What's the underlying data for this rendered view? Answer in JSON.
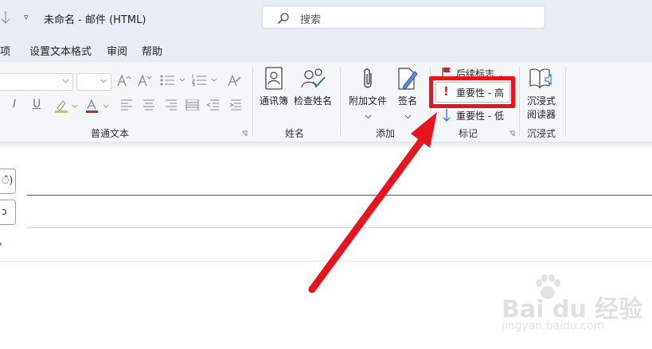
{
  "titlebar": {
    "dropdown_glyph": "▿",
    "title": "未命名  -  邮件 (HTML)"
  },
  "search": {
    "placeholder": "搜索"
  },
  "menubar": {
    "items": [
      "选项",
      "设置文本格式",
      "审阅",
      "帮助"
    ]
  },
  "ribbon": {
    "font_group": {
      "label": "普通文本"
    },
    "names_group": {
      "label": "姓名",
      "address_book": "通讯簿",
      "check_names": "检查姓名"
    },
    "add_group": {
      "label": "添加",
      "attach_file": "附加文件",
      "signature": "签名"
    },
    "tags_group": {
      "label": "标记",
      "follow_up": "后续标志",
      "high_importance": "重要性 - 高",
      "low_importance": "重要性 - 低"
    },
    "immersive_group": {
      "label": "沉浸式",
      "immersive_reader_line1": "沉浸式",
      "immersive_reader_line2": "阅读器"
    }
  },
  "compose": {
    "to_button": "ੋ)",
    "cc_button": "ɔ"
  },
  "watermark": {
    "brand": "Bai du 经验",
    "url": "jingyan.baidu.com"
  },
  "colors": {
    "highlight_red": "#e8141c",
    "to_underline": "#1e6b55",
    "titlebar_bg": "#e8ecf4",
    "ribbon_bg": "#f5f6f8"
  },
  "icons": [
    "arrow-down-icon",
    "search-icon",
    "font-size-icons",
    "bullet-list-icon",
    "numbered-list-icon",
    "clear-format-icon",
    "italic-icon",
    "underline-icon",
    "highlight-pen-icon",
    "font-color-icon",
    "align-icons",
    "indent-icons",
    "address-book-icon",
    "check-names-icon",
    "paperclip-icon",
    "signature-pen-icon",
    "flag-icon",
    "exclamation-icon",
    "down-arrow-icon",
    "immersive-reader-icon",
    "red-arrow-annotation"
  ]
}
